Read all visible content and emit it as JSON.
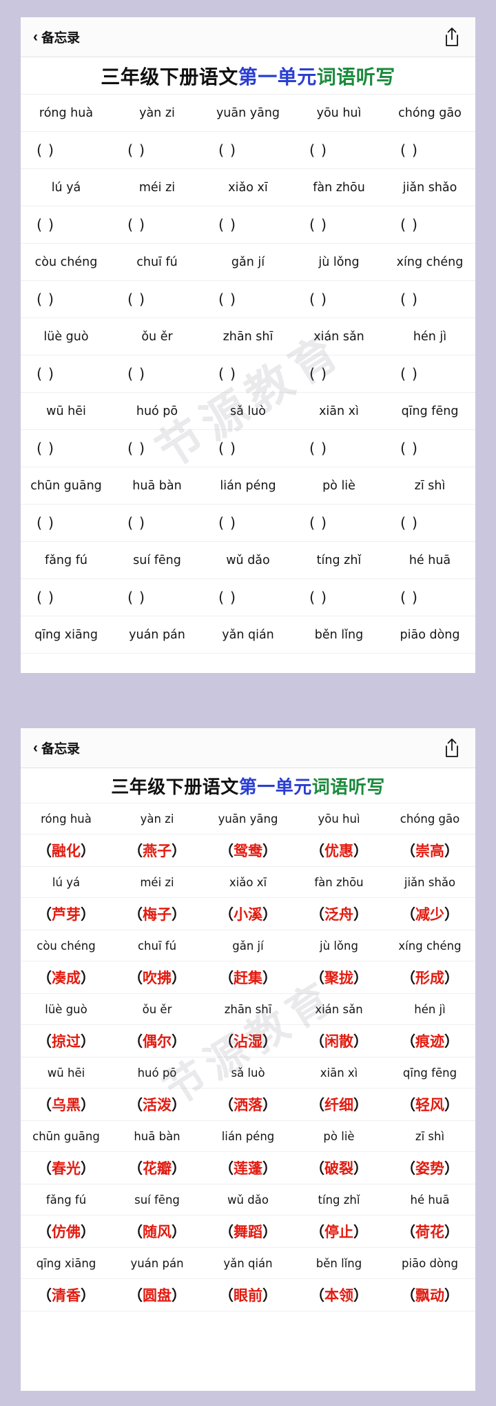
{
  "background_color": "#c9c6de",
  "navbar": {
    "back_label": "备忘录",
    "back_chevron": "‹",
    "share_icon": "share-icon"
  },
  "title": {
    "part1": "三年级下册语文",
    "part1_color": "#111111",
    "part2": "第一单元",
    "part2_color": "#2a3ed1",
    "part3": "词语听写",
    "part3_color": "#1a8a3c"
  },
  "watermark": {
    "text": "节源教育"
  },
  "blank_marker": {
    "open": "（",
    "close": "）",
    "text": "(        )"
  },
  "worksheet": {
    "rows": [
      {
        "pinyin": [
          "róng huà",
          "yàn zi",
          "yuān yāng",
          "yōu huì",
          "chóng gāo"
        ],
        "answers": [
          "融化",
          "燕子",
          "鸳鸯",
          "优惠",
          "崇高"
        ]
      },
      {
        "pinyin": [
          "lú yá",
          "méi zi",
          "xiǎo xī",
          "fàn zhōu",
          "jiǎn shǎo"
        ],
        "answers": [
          "芦芽",
          "梅子",
          "小溪",
          "泛舟",
          "减少"
        ]
      },
      {
        "pinyin": [
          "còu chéng",
          "chuī fú",
          "gǎn jí",
          "jù lǒng",
          "xíng chéng"
        ],
        "answers": [
          "凑成",
          "吹拂",
          "赶集",
          "聚拢",
          "形成"
        ]
      },
      {
        "pinyin": [
          "lüè guò",
          "ǒu ěr",
          "zhān shī",
          "xián sǎn",
          "hén jì"
        ],
        "answers": [
          "掠过",
          "偶尔",
          "沾湿",
          "闲散",
          "痕迹"
        ]
      },
      {
        "pinyin": [
          "wū hēi",
          "huó pō",
          "sǎ luò",
          "xiān xì",
          "qīng fēng"
        ],
        "answers": [
          "乌黑",
          "活泼",
          "洒落",
          "纤细",
          "轻风"
        ]
      },
      {
        "pinyin": [
          "chūn guāng",
          "huā bàn",
          "lián péng",
          "pò liè",
          "zī shì"
        ],
        "answers": [
          "春光",
          "花瓣",
          "莲蓬",
          "破裂",
          "姿势"
        ]
      },
      {
        "pinyin": [
          "fǎng fú",
          "suí fēng",
          "wǔ dǎo",
          "tíng zhǐ",
          "hé huā"
        ],
        "answers": [
          "仿佛",
          "随风",
          "舞蹈",
          "停止",
          "荷花"
        ]
      },
      {
        "pinyin": [
          "qīng xiāng",
          "yuán pán",
          "yǎn qián",
          "běn lǐng",
          "piāo dòng"
        ],
        "answers": [
          "清香",
          "圆盘",
          "眼前",
          "本领",
          "飘动"
        ]
      }
    ]
  },
  "colors": {
    "answer_red": "#e21b10",
    "paren_black": "#111111",
    "rule_line": "#efefef"
  }
}
